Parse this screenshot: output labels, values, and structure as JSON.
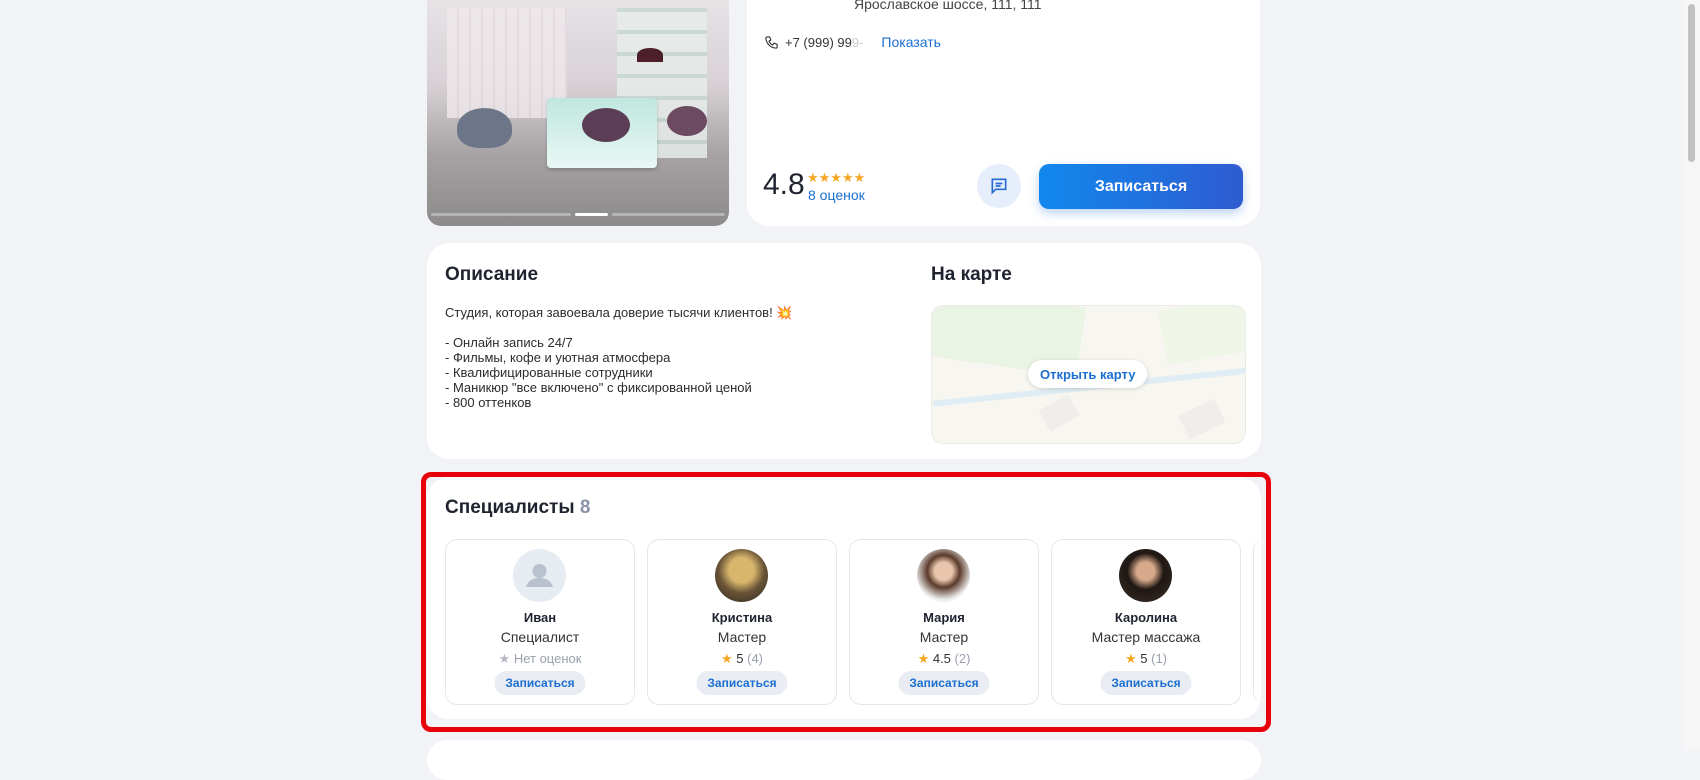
{
  "info": {
    "address": "Ярославское шоссе, 111, 111",
    "phone": "+7 (999) 99",
    "phone_hidden": "9-",
    "show_phone": "Показать",
    "rating": "4.8",
    "stars": "★★★★★",
    "reviews": "8 оценок",
    "book_label": "Записаться"
  },
  "description": {
    "title": "Описание",
    "lines": [
      "Студия, которая завоевала доверие тысячи клиентов! 💥",
      "",
      "- Онлайн запись 24/7",
      "- Фильмы, кофе и уютная атмосфера",
      "- Квалифицированные сотрудники",
      "- Маникюр \"все включено\" с фиксированной ценой",
      "- 800 оттенков"
    ]
  },
  "map": {
    "title": "На карте",
    "open_label": "Открыть карту"
  },
  "specialists": {
    "title": "Специалисты",
    "count": "8",
    "items": [
      {
        "name": "Иван",
        "role": "Специалист",
        "rating": "",
        "reviews": "Нет оценок",
        "book": "Записаться"
      },
      {
        "name": "Кристина",
        "role": "Мастер",
        "rating": "5",
        "reviews": "(4)",
        "book": "Записаться"
      },
      {
        "name": "Мария",
        "role": "Мастер",
        "rating": "4.5",
        "reviews": "(2)",
        "book": "Записаться"
      },
      {
        "name": "Каролина",
        "role": "Мастер массажа",
        "rating": "5",
        "reviews": "(1)",
        "book": "Записаться"
      }
    ]
  },
  "colors": {
    "accent": "#1b6fd1",
    "highlight_outline": "#e8000a",
    "star": "#f5a623"
  }
}
